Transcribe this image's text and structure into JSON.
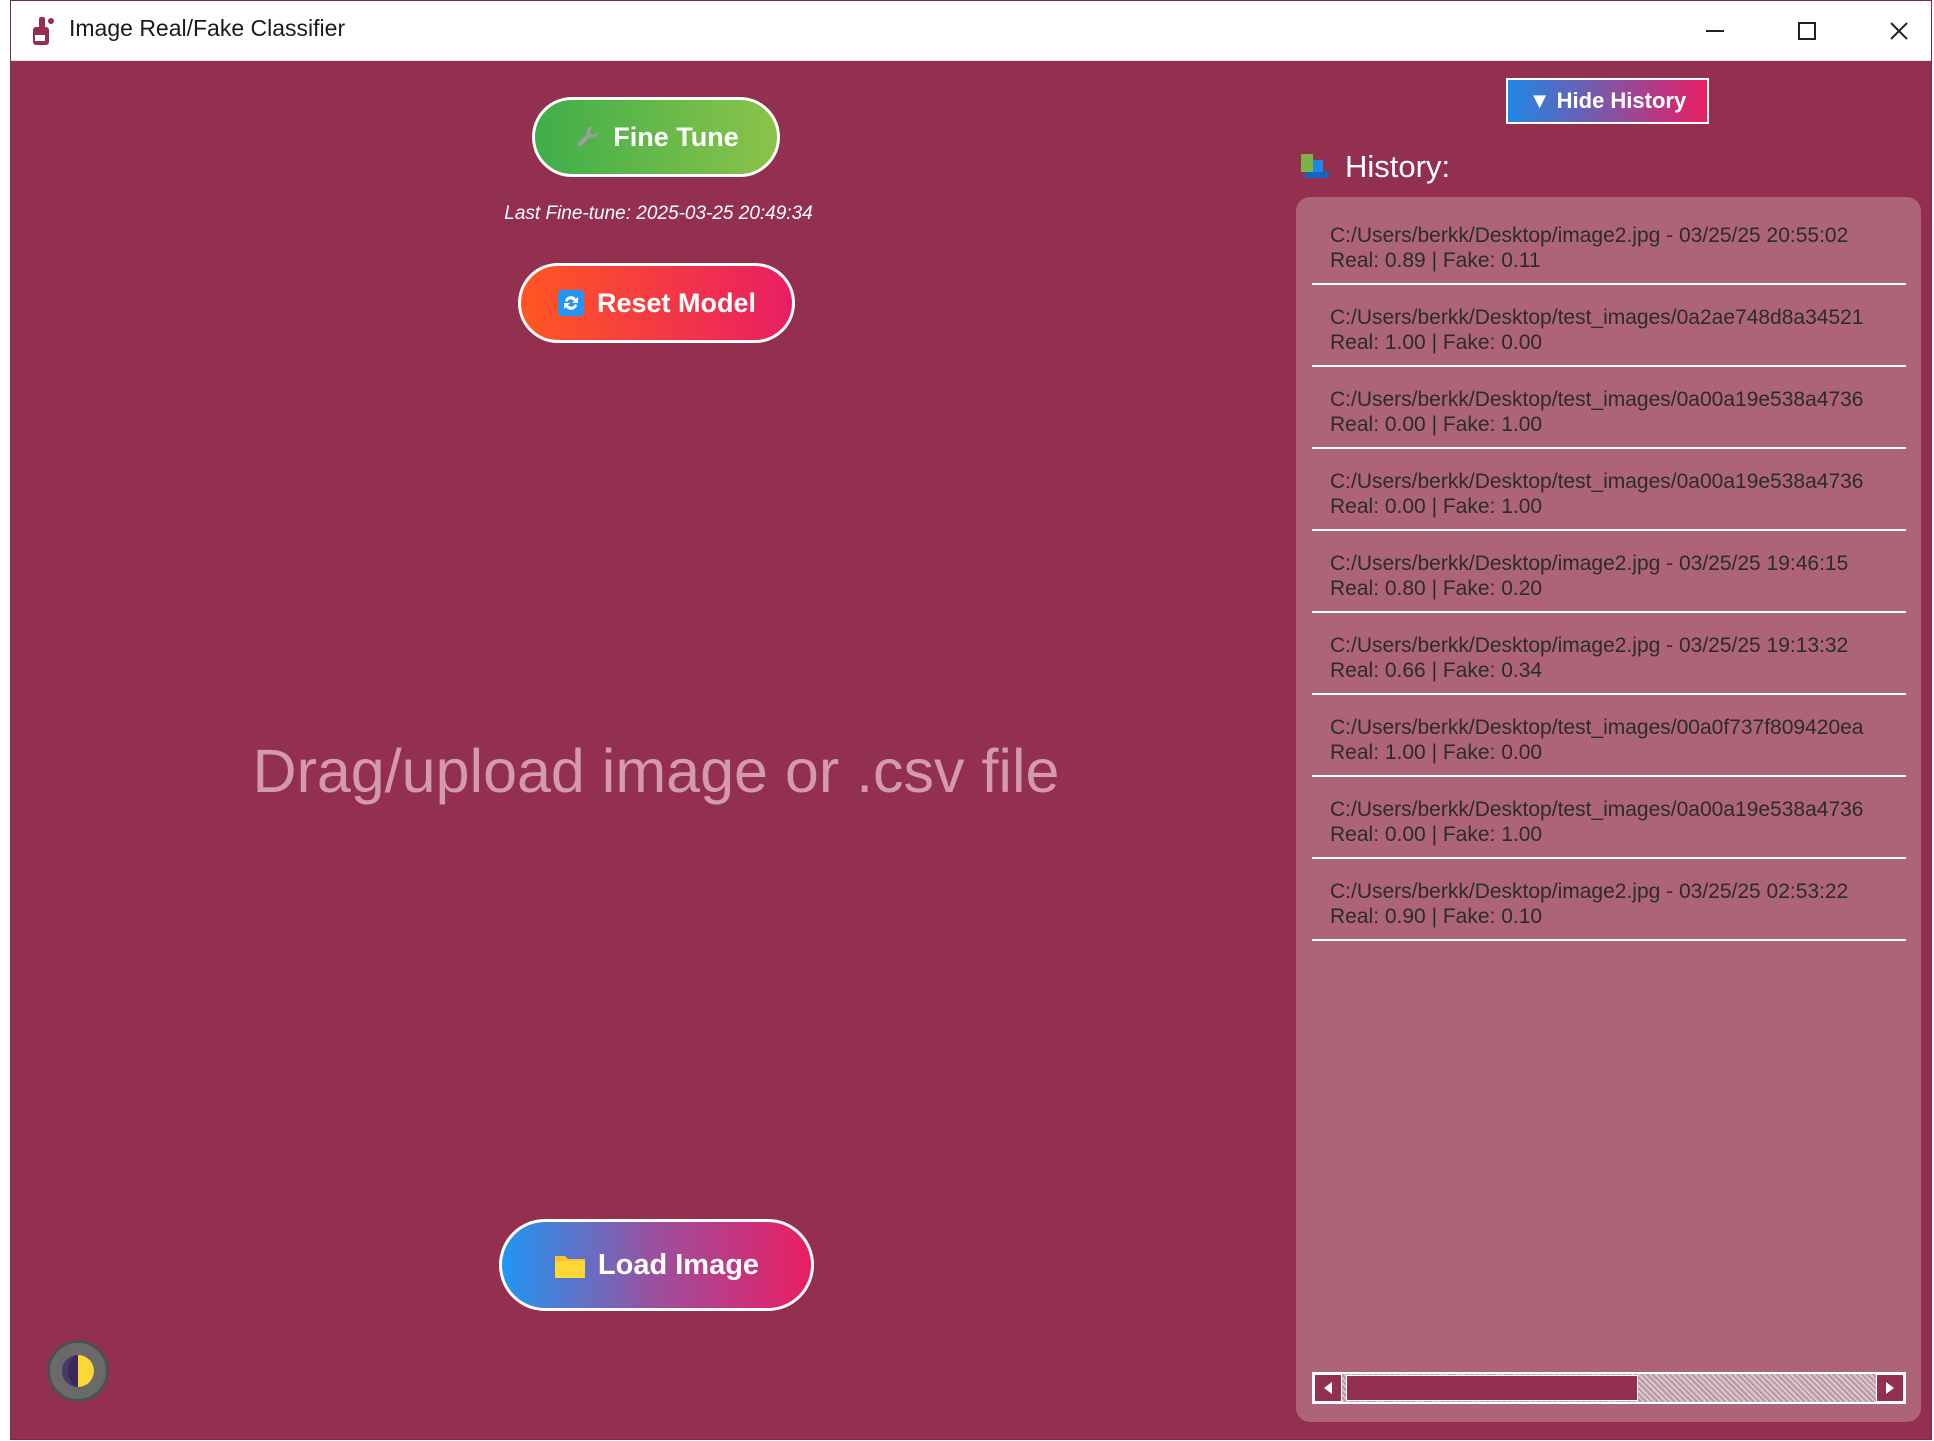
{
  "window": {
    "title": "Image Real/Fake Classifier"
  },
  "controls": {
    "fine_tune_label": "Fine Tune",
    "fine_tune_icon": "wrench-icon",
    "last_fine_tune": "Last Fine-tune: 2025-03-25 20:49:34",
    "reset_label": "Reset Model",
    "reset_icon": "refresh-icon",
    "load_label": "Load Image",
    "load_icon": "folder-icon"
  },
  "dropzone": {
    "text": "Drag/upload image or .csv file"
  },
  "history": {
    "toggle_label": "▼ Hide History",
    "heading": "History:",
    "items": [
      {
        "path": "C:/Users/berkk/Desktop/image2.jpg - 03/25/25 20:55:02",
        "scores": "Real: 0.89 | Fake: 0.11"
      },
      {
        "path": "C:/Users/berkk/Desktop/test_images/0a2ae748d8a34521",
        "scores": "Real: 1.00 | Fake: 0.00"
      },
      {
        "path": "C:/Users/berkk/Desktop/test_images/0a00a19e538a4736",
        "scores": "Real: 0.00 | Fake: 1.00"
      },
      {
        "path": "C:/Users/berkk/Desktop/test_images/0a00a19e538a4736",
        "scores": "Real: 0.00 | Fake: 1.00"
      },
      {
        "path": "C:/Users/berkk/Desktop/image2.jpg - 03/25/25 19:46:15",
        "scores": "Real: 0.80 | Fake: 0.20"
      },
      {
        "path": "C:/Users/berkk/Desktop/image2.jpg - 03/25/25 19:13:32",
        "scores": "Real: 0.66 | Fake: 0.34"
      },
      {
        "path": "C:/Users/berkk/Desktop/test_images/00a0f737f809420ea",
        "scores": "Real: 1.00 | Fake: 0.00"
      },
      {
        "path": "C:/Users/berkk/Desktop/test_images/0a00a19e538a4736",
        "scores": "Real: 0.00 | Fake: 1.00"
      },
      {
        "path": "C:/Users/berkk/Desktop/image2.jpg - 03/25/25 02:53:22",
        "scores": "Real: 0.90 | Fake: 0.10"
      }
    ]
  },
  "colors": {
    "background": "#93304f",
    "panel": "#ae6478",
    "fine_tune_gradient": [
      "#3fae4a",
      "#8bc34a"
    ],
    "reset_gradient": [
      "#ff5722",
      "#e91e63"
    ],
    "load_gradient": [
      "#2196f3",
      "#e91e63"
    ]
  }
}
